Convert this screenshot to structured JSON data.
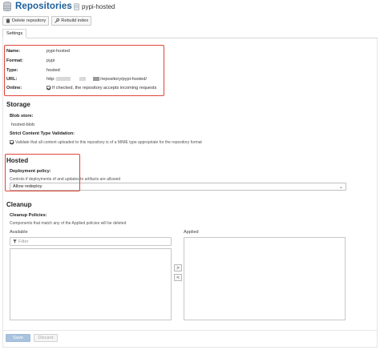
{
  "header": {
    "title": "Repositories",
    "separator": "/",
    "breadcrumb": "pypi-hosted"
  },
  "toolbar": {
    "delete_label": "Delete repository",
    "rebuild_label": "Rebuild index"
  },
  "tabs": [
    {
      "label": "Settings",
      "active": true
    }
  ],
  "summary": {
    "name_label": "Name:",
    "name_value": "pypi-hosted",
    "format_label": "Format:",
    "format_value": "pypi",
    "type_label": "Type:",
    "type_value": "hosted",
    "url_label": "URL:",
    "url_prefix": "http:",
    "url_suffix": "/repository/pypi-hosted/",
    "online_label": "Online:",
    "online_checked": true,
    "online_text": "If checked, the repository accepts incoming requests"
  },
  "storage": {
    "heading": "Storage",
    "blob_label": "Blob store:",
    "blob_value": "hosted-blob",
    "strict_label": "Strict Content Type Validation:",
    "strict_checked": true,
    "strict_text": "Validate that all content uploaded to this repository is of a MIME type appropriate for the repository format"
  },
  "hosted": {
    "heading": "Hosted",
    "policy_label": "Deployment policy:",
    "policy_hint": "Controls if deployments of and updates to artifacts are allowed",
    "policy_value": "Allow redeploy"
  },
  "cleanup": {
    "heading": "Cleanup",
    "policies_label": "Cleanup Policies:",
    "policies_hint": "Components that match any of the Applied policies will be deleted",
    "available_label": "Available",
    "applied_label": "Applied",
    "filter_placeholder": "Filter",
    "add_symbol": ">",
    "remove_symbol": "<"
  },
  "footer": {
    "save_label": "Save",
    "discard_label": "Discard"
  },
  "colors": {
    "title": "#1a5f9c",
    "highlight": "#e0453a",
    "save_disabled": "#a9c3de"
  },
  "icons": [
    "database-icon",
    "repository-icon",
    "trash-icon",
    "wrench-icon",
    "filter-icon",
    "chevron-down-icon"
  ]
}
